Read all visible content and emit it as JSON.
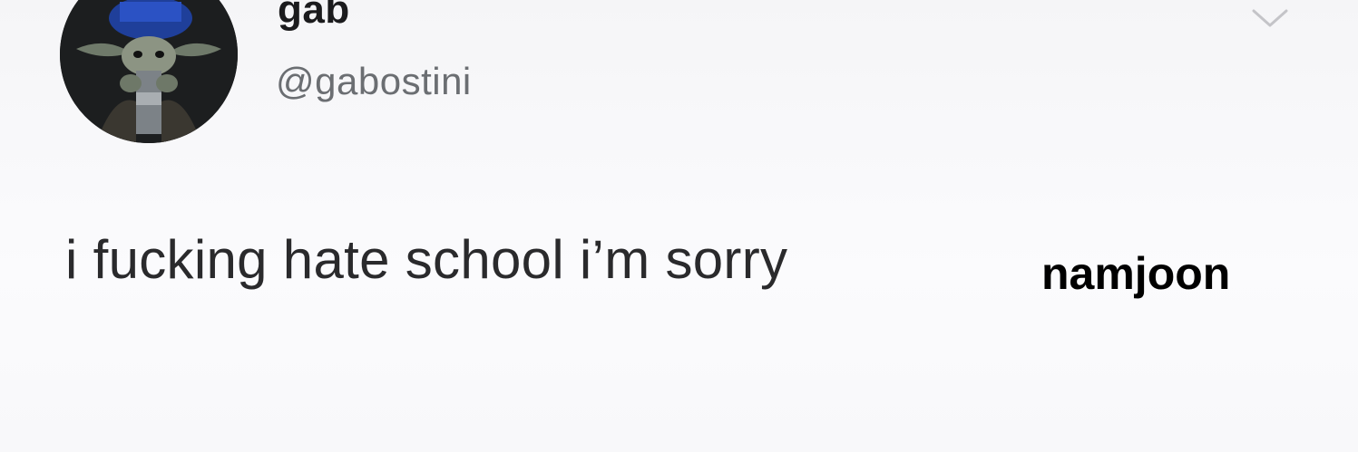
{
  "tweet": {
    "display_name": "gab",
    "handle": "@gabostini",
    "text": "i fucking hate school i’m sorry",
    "avatar_icon": "baby-yoda-avatar",
    "menu_icon": "chevron-down-icon"
  },
  "caption": {
    "text": "namjoon"
  },
  "colors": {
    "background": "#f7f7f9",
    "name": "#1b1b1d",
    "handle": "#6b6e72",
    "text": "#2a2a2c",
    "chevron": "#c4c4c8",
    "caption": "#000000"
  }
}
